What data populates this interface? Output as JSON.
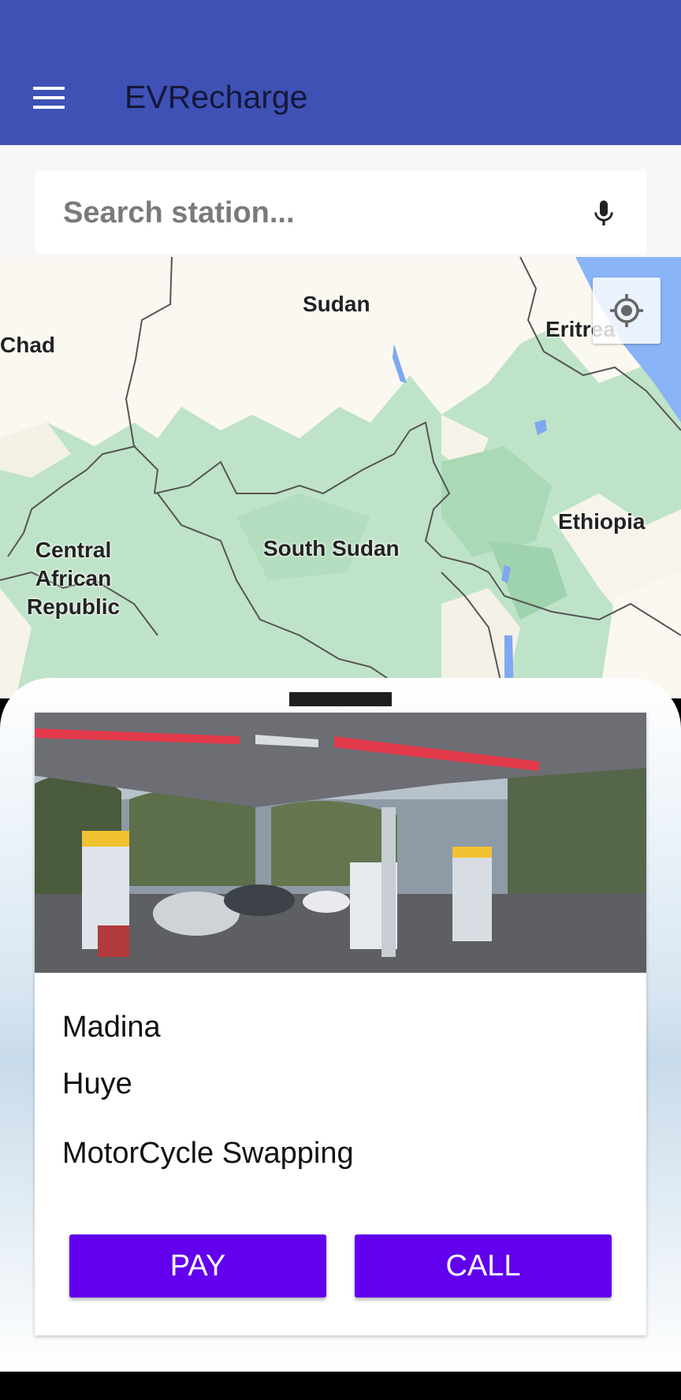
{
  "app_bar": {
    "title": "EVRecharge",
    "menu_icon": "hamburger-menu-icon",
    "color": "#3f51b5"
  },
  "search": {
    "placeholder": "Search station...",
    "value": "",
    "mic_icon": "microphone-icon"
  },
  "map": {
    "labels": {
      "sudan": "Sudan",
      "chad": "Chad",
      "eritrea": "Eritrea",
      "ethiopia": "Ethiopia",
      "south_sudan": "South Sudan",
      "car": "Central African Republic"
    },
    "locate_icon": "my-location-icon"
  },
  "station": {
    "name": "Madina",
    "location": "Huye",
    "service": "MotorCycle Swapping",
    "pay_label": "PAY",
    "call_label": "CALL",
    "button_color": "#6200ee"
  }
}
